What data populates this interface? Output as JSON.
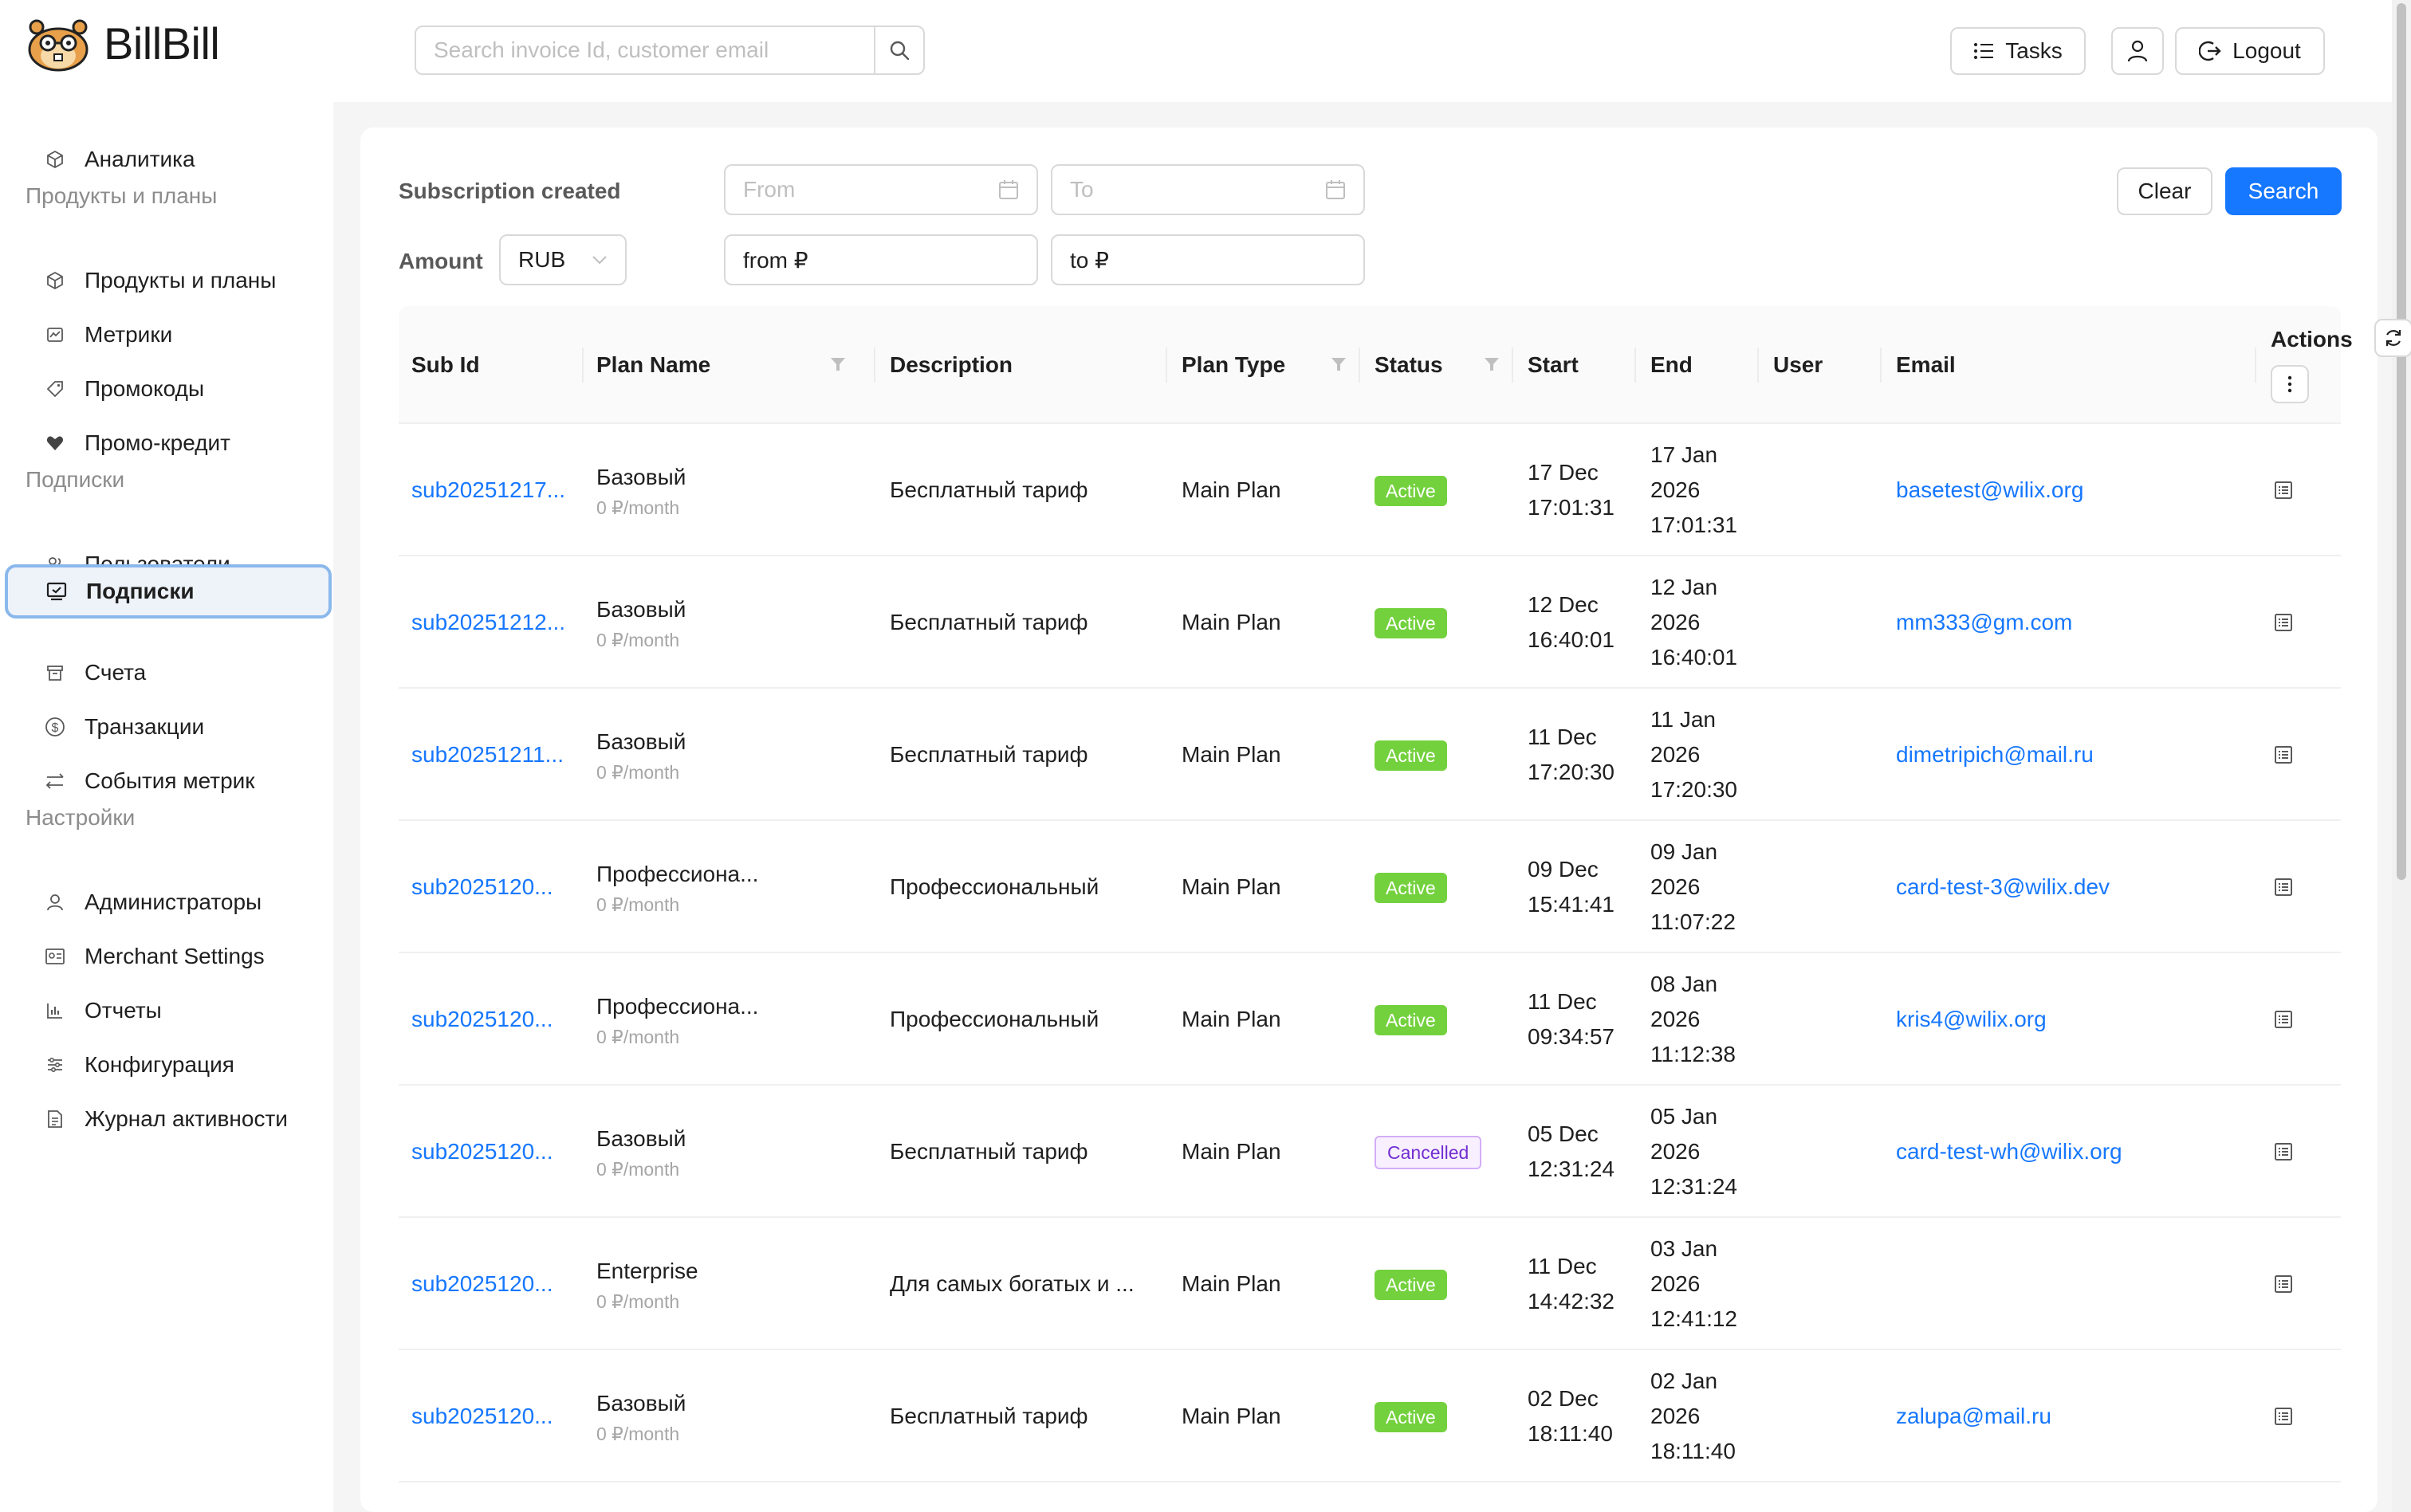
{
  "app": {
    "name": "BillBill"
  },
  "header": {
    "search_placeholder": "Search invoice Id, customer email",
    "tasks_label": "Tasks",
    "logout_label": "Logout"
  },
  "sidebar": {
    "analytics": "Аналитика",
    "group_products": "Продукты и планы",
    "products": "Продукты и планы",
    "metrics": "Метрики",
    "promocodes": "Промокоды",
    "promo_credit": "Промо-кредит",
    "group_subscriptions": "Подписки",
    "users": "Пользователи",
    "subscriptions": "Подписки",
    "invoices": "Счета",
    "transactions": "Транзакции",
    "metric_events": "События метрик",
    "group_settings": "Настройки",
    "admins": "Администраторы",
    "merchant_settings": "Merchant Settings",
    "reports": "Отчеты",
    "configuration": "Конфигурация",
    "activity_log": "Журнал активности"
  },
  "filters": {
    "created_label": "Subscription created",
    "from_placeholder": "From",
    "to_placeholder": "To",
    "amount_label": "Amount",
    "currency": "RUB",
    "amount_from": "from ₽",
    "amount_to": "to ₽",
    "clear_label": "Clear",
    "search_label": "Search"
  },
  "table": {
    "columns": {
      "sub_id": "Sub Id",
      "plan_name": "Plan Name",
      "description": "Description",
      "plan_type": "Plan Type",
      "status": "Status",
      "start": "Start",
      "end": "End",
      "user": "User",
      "email": "Email",
      "actions": "Actions"
    },
    "rows": [
      {
        "sub_id": "sub20251217...",
        "plan": "Базовый",
        "price": "0 ₽/month",
        "description": "Бесплатный тариф",
        "plan_type": "Main Plan",
        "status": "Active",
        "start_date": "17 Dec",
        "start_time": "17:01:31",
        "end_date": "17 Jan",
        "end_year": "2026",
        "end_time": "17:01:31",
        "user": "",
        "email": "basetest@wilix.org"
      },
      {
        "sub_id": "sub20251212...",
        "plan": "Базовый",
        "price": "0 ₽/month",
        "description": "Бесплатный тариф",
        "plan_type": "Main Plan",
        "status": "Active",
        "start_date": "12 Dec",
        "start_time": "16:40:01",
        "end_date": "12 Jan",
        "end_year": "2026",
        "end_time": "16:40:01",
        "user": "",
        "email": "mm333@gm.com"
      },
      {
        "sub_id": "sub20251211...",
        "plan": "Базовый",
        "price": "0 ₽/month",
        "description": "Бесплатный тариф",
        "plan_type": "Main Plan",
        "status": "Active",
        "start_date": "11 Dec",
        "start_time": "17:20:30",
        "end_date": "11 Jan",
        "end_year": "2026",
        "end_time": "17:20:30",
        "user": "",
        "email": "dimetripich@mail.ru"
      },
      {
        "sub_id": "sub2025120...",
        "plan": "Профессиона...",
        "price": "0 ₽/month",
        "description": "Профессиональный",
        "plan_type": "Main Plan",
        "status": "Active",
        "start_date": "09 Dec",
        "start_time": "15:41:41",
        "end_date": "09 Jan",
        "end_year": "2026",
        "end_time": "11:07:22",
        "user": "",
        "email": "card-test-3@wilix.dev"
      },
      {
        "sub_id": "sub2025120...",
        "plan": "Профессиона...",
        "price": "0 ₽/month",
        "description": "Профессиональный",
        "plan_type": "Main Plan",
        "status": "Active",
        "start_date": "11 Dec",
        "start_time": "09:34:57",
        "end_date": "08 Jan",
        "end_year": "2026",
        "end_time": "11:12:38",
        "user": "",
        "email": "kris4@wilix.org"
      },
      {
        "sub_id": "sub2025120...",
        "plan": "Базовый",
        "price": "0 ₽/month",
        "description": "Бесплатный тариф",
        "plan_type": "Main Plan",
        "status": "Cancelled",
        "start_date": "05 Dec",
        "start_time": "12:31:24",
        "end_date": "05 Jan",
        "end_year": "2026",
        "end_time": "12:31:24",
        "user": "",
        "email": "card-test-wh@wilix.org"
      },
      {
        "sub_id": "sub2025120...",
        "plan": "Enterprise",
        "price": "0 ₽/month",
        "description": "Для самых богатых и ...",
        "plan_type": "Main Plan",
        "status": "Active",
        "start_date": "11 Dec",
        "start_time": "14:42:32",
        "end_date": "03 Jan",
        "end_year": "2026",
        "end_time": "12:41:12",
        "user": "",
        "email": ""
      },
      {
        "sub_id": "sub2025120...",
        "plan": "Базовый",
        "price": "0 ₽/month",
        "description": "Бесплатный тариф",
        "plan_type": "Main Plan",
        "status": "Active",
        "start_date": "02 Dec",
        "start_time": "18:11:40",
        "end_date": "02 Jan",
        "end_year": "2026",
        "end_time": "18:11:40",
        "user": "",
        "email": "zalupa@mail.ru"
      }
    ]
  },
  "colors": {
    "primary": "#1677ff",
    "active_badge": "#73d13d",
    "cancelled_badge_text": "#722ed1",
    "selected_nav_border": "#8ab8ec"
  }
}
